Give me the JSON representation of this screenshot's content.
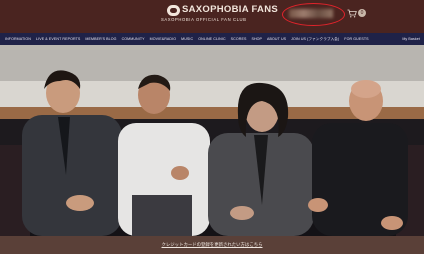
{
  "brand": {
    "title": "SAXOPHOBIA FANS",
    "subtitle": "SAXOPHOBIA OFFICIAL FAN CLUB"
  },
  "header": {
    "cart_count": "0"
  },
  "nav": {
    "items": [
      "INFORMATION",
      "LIVE & EVENT REPORTS",
      "MEMBER'S BLOG",
      "COMMUNITY",
      "MOVIE&RADIO",
      "MUSIC",
      "ONLINE CLINIC",
      "SCORES",
      "SHOP",
      "ABOUT US",
      "JOIN US (ファンクラブ入会)",
      "FOR GUESTS"
    ],
    "signin": "My Basket"
  },
  "footer": {
    "link": "クレジットカードの登録を更新されたい方はこちら"
  },
  "colors": {
    "header_bg": "#4a2420",
    "nav_bg": "#1f2248",
    "annotation": "#e0232b"
  }
}
